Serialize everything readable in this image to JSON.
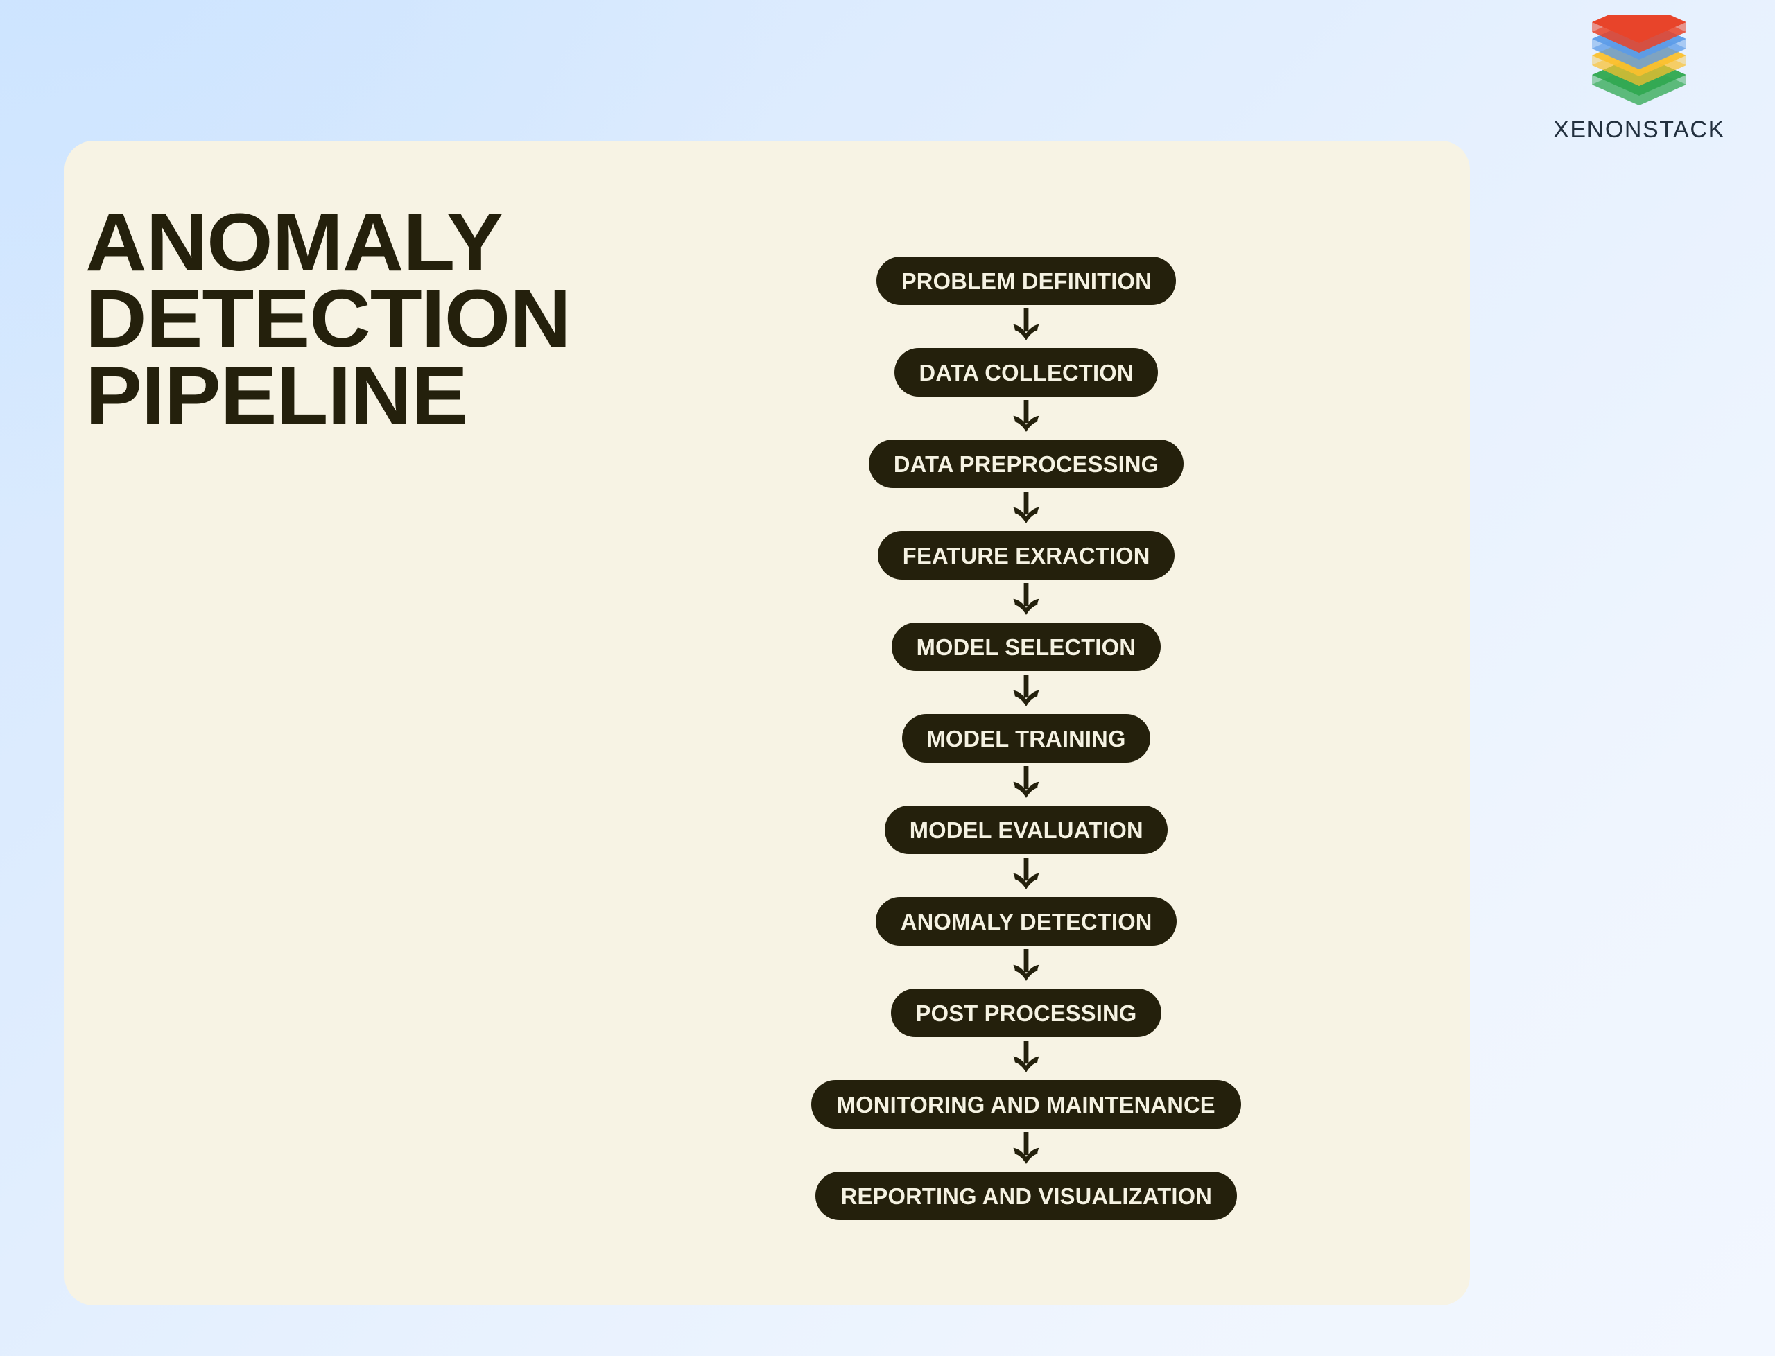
{
  "brand": {
    "name": "XENONSTACK",
    "logo_layers": [
      {
        "name": "red-layer",
        "color": "#E8442A"
      },
      {
        "name": "blue-layer",
        "color": "#5B9BE8"
      },
      {
        "name": "yellow-layer",
        "color": "#FBC02D"
      },
      {
        "name": "green-layer",
        "color": "#2EA84F"
      }
    ],
    "text_color": "#22303F"
  },
  "card": {
    "background": "#F7F3E4"
  },
  "page": {
    "background_start": "#D4E8FF",
    "background_end": "#EFF5FE"
  },
  "title": {
    "lines": [
      "ANOMALY",
      "DETECTION",
      "PIPELINE"
    ],
    "color": "#24200C"
  },
  "pipeline": {
    "accent": "#24200C",
    "text_color": "#F5F2E2",
    "arrow_icon": "arrow-down-icon",
    "steps": [
      {
        "label": "PROBLEM DEFINITION"
      },
      {
        "label": "DATA COLLECTION"
      },
      {
        "label": "DATA PREPROCESSING"
      },
      {
        "label": "FEATURE EXRACTION"
      },
      {
        "label": "MODEL SELECTION"
      },
      {
        "label": "MODEL TRAINING"
      },
      {
        "label": "MODEL EVALUATION"
      },
      {
        "label": "ANOMALY DETECTION"
      },
      {
        "label": "POST PROCESSING"
      },
      {
        "label": "MONITORING AND MAINTENANCE"
      },
      {
        "label": "REPORTING AND VISUALIZATION"
      }
    ]
  }
}
